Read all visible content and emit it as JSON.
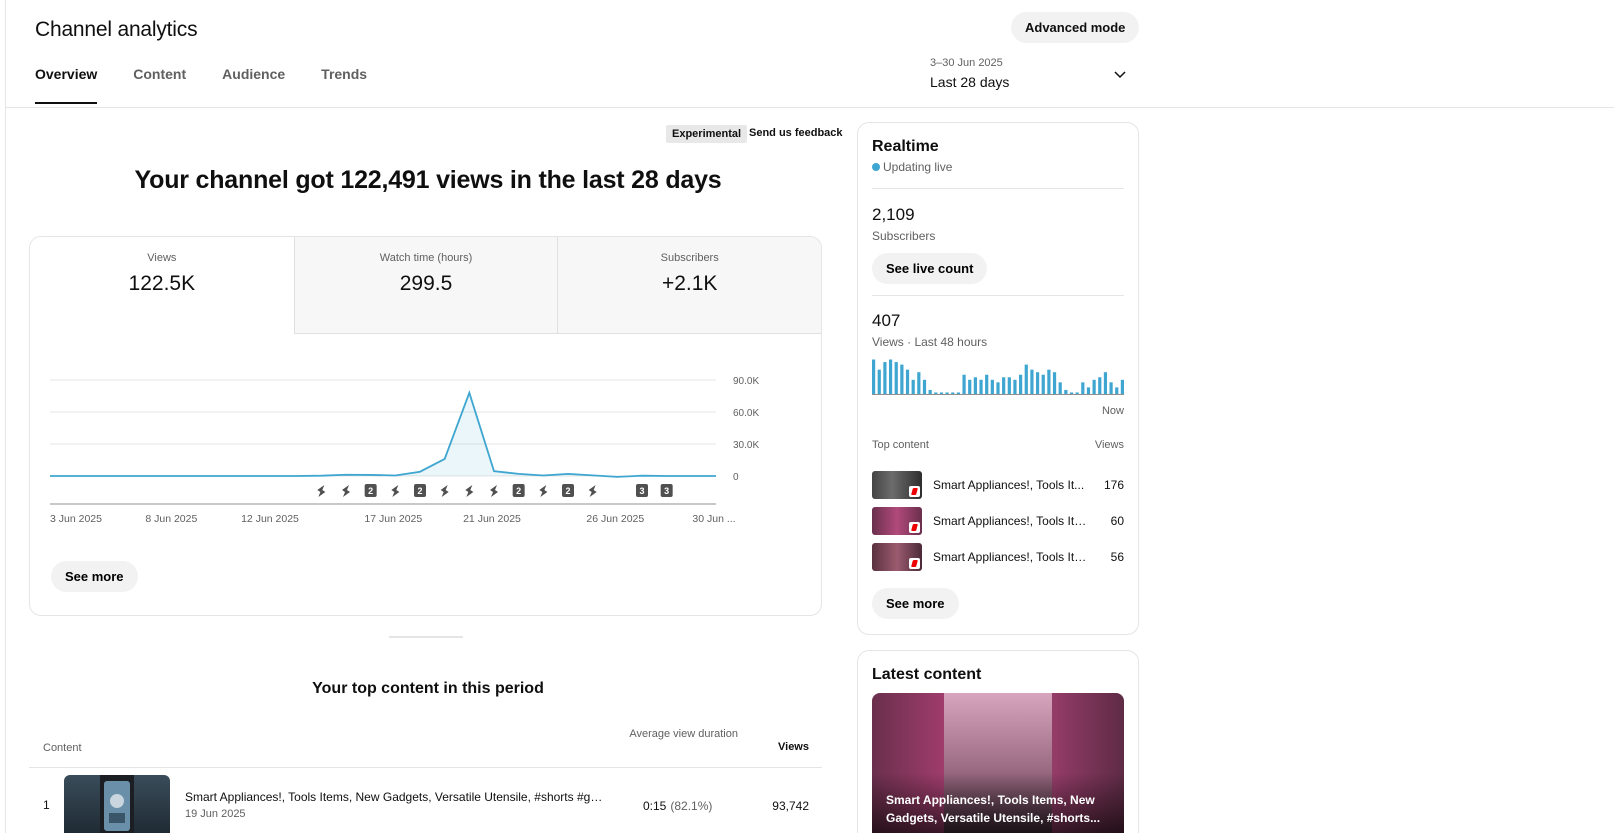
{
  "header": {
    "title": "Channel analytics",
    "advanced_mode": "Advanced mode",
    "tabs": [
      {
        "label": "Overview",
        "active": true
      },
      {
        "label": "Content",
        "active": false
      },
      {
        "label": "Audience",
        "active": false
      },
      {
        "label": "Trends",
        "active": false
      }
    ],
    "date_range": {
      "dates": "3–30 Jun 2025",
      "label": "Last 28 days"
    }
  },
  "overview": {
    "experimental": "Experimental",
    "feedback": "Send us feedback",
    "headline": "Your channel got 122,491 views in the last 28 days",
    "metrics": [
      {
        "label": "Views",
        "value": "122.5K"
      },
      {
        "label": "Watch time (hours)",
        "value": "299.5"
      },
      {
        "label": "Subscribers",
        "value": "+2.1K"
      }
    ],
    "see_more": "See more"
  },
  "chart_data": {
    "type": "area",
    "x": [
      "3 Jun 2025",
      "4 Jun",
      "5 Jun",
      "6 Jun",
      "7 Jun",
      "8 Jun 2025",
      "9 Jun",
      "10 Jun",
      "11 Jun",
      "12 Jun 2025",
      "13 Jun",
      "14 Jun",
      "15 Jun",
      "16 Jun",
      "17 Jun 2025",
      "18 Jun",
      "19 Jun",
      "20 Jun",
      "21 Jun 2025",
      "22 Jun",
      "23 Jun",
      "24 Jun",
      "25 Jun",
      "26 Jun 2025",
      "27 Jun",
      "28 Jun",
      "29 Jun",
      "30 Jun"
    ],
    "values": [
      0,
      0,
      0,
      0,
      0,
      0,
      0,
      0,
      0,
      0,
      0,
      300,
      1200,
      1000,
      500,
      4000,
      16000,
      78000,
      4500,
      2000,
      500,
      2000,
      600,
      -800,
      300,
      0,
      0,
      0
    ],
    "xticks": [
      "3 Jun 2025",
      "8 Jun 2025",
      "12 Jun 2025",
      "17 Jun 2025",
      "21 Jun 2025",
      "26 Jun 2025",
      "30 Jun ..."
    ],
    "xtick_index": [
      0,
      5,
      9,
      14,
      18,
      23,
      27
    ],
    "yticks": [
      "0",
      "30.0K",
      "60.0K",
      "90.0K"
    ],
    "ytick_values": [
      0,
      30000,
      60000,
      90000
    ],
    "ylim": [
      0,
      90000
    ],
    "color": "#3ea6d0",
    "markers": [
      {
        "index": 11,
        "label": "",
        "kind": "short"
      },
      {
        "index": 12,
        "label": "",
        "kind": "short"
      },
      {
        "index": 13,
        "label": "2",
        "kind": "count"
      },
      {
        "index": 14,
        "label": "",
        "kind": "short"
      },
      {
        "index": 15,
        "label": "2",
        "kind": "count"
      },
      {
        "index": 16,
        "label": "",
        "kind": "short"
      },
      {
        "index": 17,
        "label": "",
        "kind": "short"
      },
      {
        "index": 18,
        "label": "",
        "kind": "short"
      },
      {
        "index": 19,
        "label": "2",
        "kind": "count"
      },
      {
        "index": 20,
        "label": "",
        "kind": "short"
      },
      {
        "index": 21,
        "label": "2",
        "kind": "count"
      },
      {
        "index": 22,
        "label": "",
        "kind": "short"
      },
      {
        "index": 24,
        "label": "3",
        "kind": "count"
      },
      {
        "index": 25,
        "label": "3",
        "kind": "count"
      }
    ]
  },
  "top_content": {
    "title": "Your top content in this period",
    "columns": {
      "content": "Content",
      "avd": "Average view duration",
      "views": "Views"
    },
    "rows": [
      {
        "rank": "1",
        "title": "Smart Appliances!, Tools Items, New Gadgets, Versatile Utensile, #shorts #gadg...",
        "date": "19 Jun 2025",
        "avd": "0:15",
        "avd_pct": "(82.1%)",
        "views": "93,742"
      }
    ]
  },
  "realtime": {
    "title": "Realtime",
    "status": "Updating live",
    "subscribers": "2,109",
    "subscribers_label": "Subscribers",
    "live_count_btn": "See live count",
    "views": "407",
    "views_label": "Views · Last 48 hours",
    "now": "Now",
    "bars": [
      28,
      20,
      26,
      28,
      26,
      24,
      20,
      12,
      18,
      12,
      4,
      2,
      2,
      2,
      2,
      2,
      16,
      12,
      14,
      12,
      16,
      12,
      10,
      14,
      14,
      12,
      16,
      24,
      20,
      18,
      16,
      20,
      18,
      10,
      4,
      2,
      2,
      10,
      6,
      12,
      14,
      18,
      10,
      6,
      12
    ],
    "top_content_label": "Top content",
    "views_col": "Views",
    "items": [
      {
        "title": "Smart Appliances!, Tools It...",
        "views": "176"
      },
      {
        "title": "Smart Appliances!, Tools Ite...",
        "views": "60"
      },
      {
        "title": "Smart Appliances!, Tools Ite...",
        "views": "56"
      }
    ],
    "see_more": "See more"
  },
  "latest": {
    "title": "Latest content",
    "caption": "Smart Appliances!, Tools Items, New Gadgets, Versatile Utensile, #shorts..."
  }
}
